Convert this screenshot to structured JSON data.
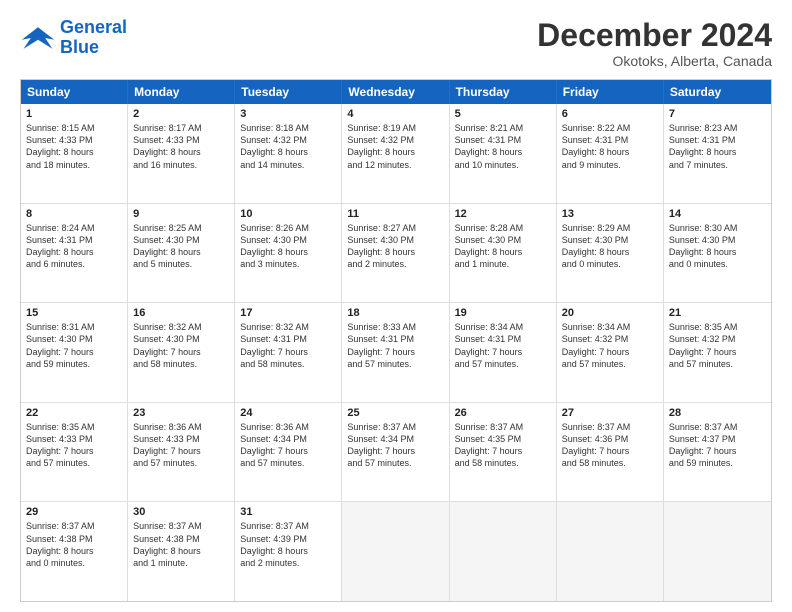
{
  "logo": {
    "line1": "General",
    "line2": "Blue"
  },
  "title": "December 2024",
  "subtitle": "Okotoks, Alberta, Canada",
  "days": [
    "Sunday",
    "Monday",
    "Tuesday",
    "Wednesday",
    "Thursday",
    "Friday",
    "Saturday"
  ],
  "weeks": [
    [
      {
        "day": "1",
        "text": "Sunrise: 8:15 AM\nSunset: 4:33 PM\nDaylight: 8 hours\nand 18 minutes."
      },
      {
        "day": "2",
        "text": "Sunrise: 8:17 AM\nSunset: 4:33 PM\nDaylight: 8 hours\nand 16 minutes."
      },
      {
        "day": "3",
        "text": "Sunrise: 8:18 AM\nSunset: 4:32 PM\nDaylight: 8 hours\nand 14 minutes."
      },
      {
        "day": "4",
        "text": "Sunrise: 8:19 AM\nSunset: 4:32 PM\nDaylight: 8 hours\nand 12 minutes."
      },
      {
        "day": "5",
        "text": "Sunrise: 8:21 AM\nSunset: 4:31 PM\nDaylight: 8 hours\nand 10 minutes."
      },
      {
        "day": "6",
        "text": "Sunrise: 8:22 AM\nSunset: 4:31 PM\nDaylight: 8 hours\nand 9 minutes."
      },
      {
        "day": "7",
        "text": "Sunrise: 8:23 AM\nSunset: 4:31 PM\nDaylight: 8 hours\nand 7 minutes."
      }
    ],
    [
      {
        "day": "8",
        "text": "Sunrise: 8:24 AM\nSunset: 4:31 PM\nDaylight: 8 hours\nand 6 minutes."
      },
      {
        "day": "9",
        "text": "Sunrise: 8:25 AM\nSunset: 4:30 PM\nDaylight: 8 hours\nand 5 minutes."
      },
      {
        "day": "10",
        "text": "Sunrise: 8:26 AM\nSunset: 4:30 PM\nDaylight: 8 hours\nand 3 minutes."
      },
      {
        "day": "11",
        "text": "Sunrise: 8:27 AM\nSunset: 4:30 PM\nDaylight: 8 hours\nand 2 minutes."
      },
      {
        "day": "12",
        "text": "Sunrise: 8:28 AM\nSunset: 4:30 PM\nDaylight: 8 hours\nand 1 minute."
      },
      {
        "day": "13",
        "text": "Sunrise: 8:29 AM\nSunset: 4:30 PM\nDaylight: 8 hours\nand 0 minutes."
      },
      {
        "day": "14",
        "text": "Sunrise: 8:30 AM\nSunset: 4:30 PM\nDaylight: 8 hours\nand 0 minutes."
      }
    ],
    [
      {
        "day": "15",
        "text": "Sunrise: 8:31 AM\nSunset: 4:30 PM\nDaylight: 7 hours\nand 59 minutes."
      },
      {
        "day": "16",
        "text": "Sunrise: 8:32 AM\nSunset: 4:30 PM\nDaylight: 7 hours\nand 58 minutes."
      },
      {
        "day": "17",
        "text": "Sunrise: 8:32 AM\nSunset: 4:31 PM\nDaylight: 7 hours\nand 58 minutes."
      },
      {
        "day": "18",
        "text": "Sunrise: 8:33 AM\nSunset: 4:31 PM\nDaylight: 7 hours\nand 57 minutes."
      },
      {
        "day": "19",
        "text": "Sunrise: 8:34 AM\nSunset: 4:31 PM\nDaylight: 7 hours\nand 57 minutes."
      },
      {
        "day": "20",
        "text": "Sunrise: 8:34 AM\nSunset: 4:32 PM\nDaylight: 7 hours\nand 57 minutes."
      },
      {
        "day": "21",
        "text": "Sunrise: 8:35 AM\nSunset: 4:32 PM\nDaylight: 7 hours\nand 57 minutes."
      }
    ],
    [
      {
        "day": "22",
        "text": "Sunrise: 8:35 AM\nSunset: 4:33 PM\nDaylight: 7 hours\nand 57 minutes."
      },
      {
        "day": "23",
        "text": "Sunrise: 8:36 AM\nSunset: 4:33 PM\nDaylight: 7 hours\nand 57 minutes."
      },
      {
        "day": "24",
        "text": "Sunrise: 8:36 AM\nSunset: 4:34 PM\nDaylight: 7 hours\nand 57 minutes."
      },
      {
        "day": "25",
        "text": "Sunrise: 8:37 AM\nSunset: 4:34 PM\nDaylight: 7 hours\nand 57 minutes."
      },
      {
        "day": "26",
        "text": "Sunrise: 8:37 AM\nSunset: 4:35 PM\nDaylight: 7 hours\nand 58 minutes."
      },
      {
        "day": "27",
        "text": "Sunrise: 8:37 AM\nSunset: 4:36 PM\nDaylight: 7 hours\nand 58 minutes."
      },
      {
        "day": "28",
        "text": "Sunrise: 8:37 AM\nSunset: 4:37 PM\nDaylight: 7 hours\nand 59 minutes."
      }
    ],
    [
      {
        "day": "29",
        "text": "Sunrise: 8:37 AM\nSunset: 4:38 PM\nDaylight: 8 hours\nand 0 minutes."
      },
      {
        "day": "30",
        "text": "Sunrise: 8:37 AM\nSunset: 4:38 PM\nDaylight: 8 hours\nand 1 minute."
      },
      {
        "day": "31",
        "text": "Sunrise: 8:37 AM\nSunset: 4:39 PM\nDaylight: 8 hours\nand 2 minutes."
      },
      {
        "day": "",
        "text": ""
      },
      {
        "day": "",
        "text": ""
      },
      {
        "day": "",
        "text": ""
      },
      {
        "day": "",
        "text": ""
      }
    ]
  ]
}
